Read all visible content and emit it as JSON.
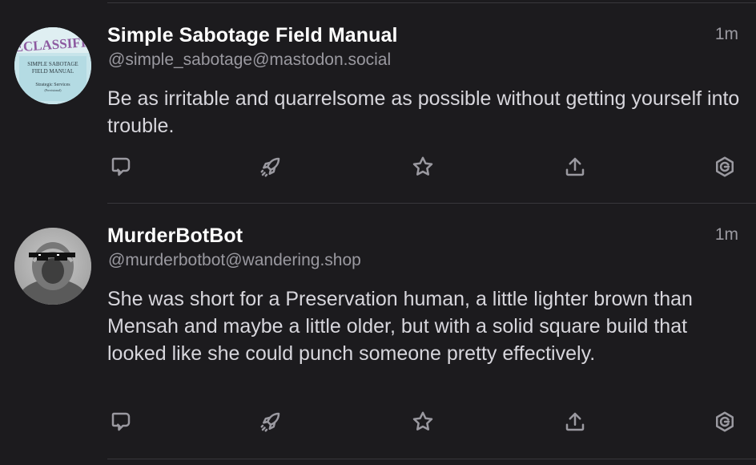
{
  "posts": [
    {
      "display_name": "Simple Sabotage Field Manual",
      "handle": "@simple_sabotage@mastodon.social",
      "time": "1m",
      "content": "Be as irritable and quarrelsome as possible without getting yourself into trouble.",
      "avatar": {
        "stamp": "DECLASSIFIED",
        "title_line1": "SIMPLE SABOTAGE",
        "title_line2": "FIELD MANUAL",
        "org": "Strategic Services",
        "note": "(Provisional)"
      }
    },
    {
      "display_name": "MurderBotBot",
      "handle": "@murderbotbot@wandering.shop",
      "time": "1m",
      "content": "She was short for a Preservation human, a little lighter brown than Mensah and maybe a little older, but with a solid square build that looked like she could punch someone pretty effectively.",
      "avatar": {}
    }
  ],
  "actions": [
    "reply-icon",
    "boost-icon",
    "favourite-icon",
    "share-icon",
    "more-icon"
  ],
  "colors": {
    "background": "#1c1b1e",
    "divider": "#38373b",
    "secondary_text": "#9a99a0"
  }
}
